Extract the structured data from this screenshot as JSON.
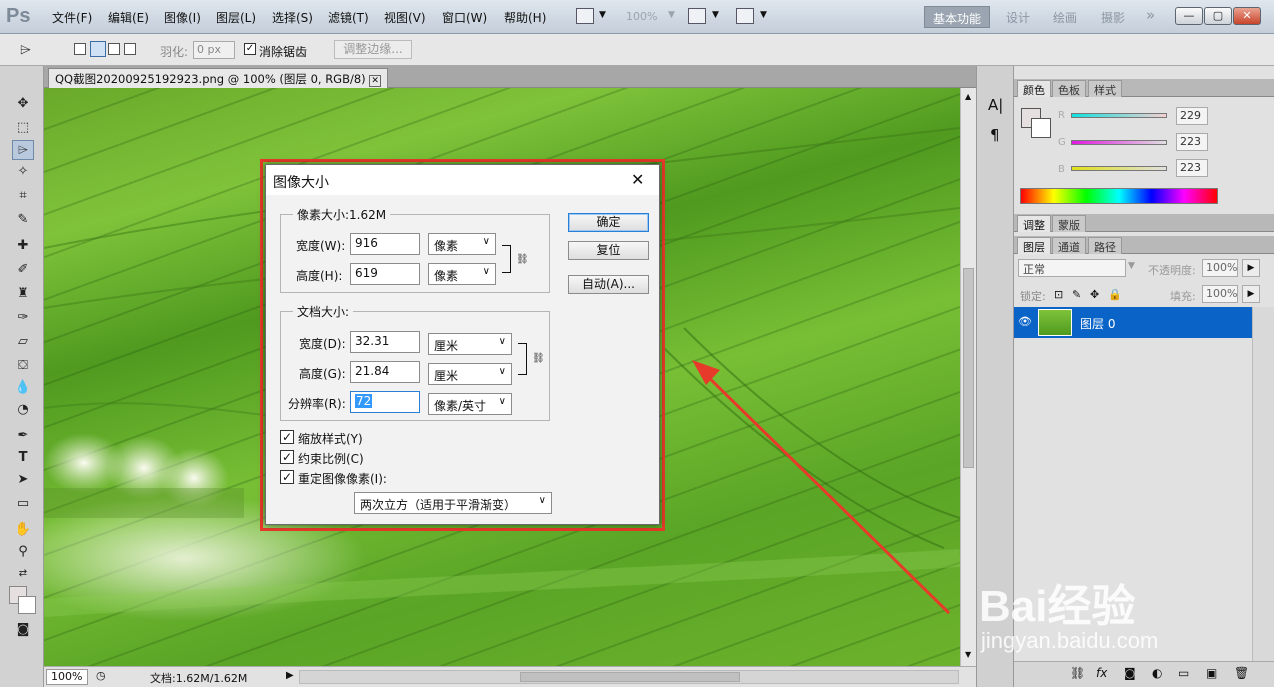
{
  "app": {
    "logo": "Ps"
  },
  "menu": [
    "文件(F)",
    "编辑(E)",
    "图像(I)",
    "图层(L)",
    "选择(S)",
    "滤镜(T)",
    "视图(V)",
    "窗口(W)",
    "帮助(H)"
  ],
  "toolbar": {
    "zoom": "100%"
  },
  "workspaces": [
    "基本功能",
    "设计",
    "绘画",
    "摄影"
  ],
  "workspace_more": "»",
  "window_buttons": [
    "—",
    "▢",
    "✕"
  ],
  "options": {
    "feather_label": "羽化:",
    "feather_value": "0 px",
    "antialias_label": "消除锯齿",
    "refine_edge": "调整边缘..."
  },
  "document": {
    "tab_title": "QQ截图20200925192923.png @ 100% (图层 0, RGB/8)",
    "zoom": "100%",
    "doc_info": "文档:1.62M/1.62M"
  },
  "panels": {
    "color_tabs": [
      "颜色",
      "色板",
      "样式"
    ],
    "r": "229",
    "g": "223",
    "b": "223",
    "r_label": "R",
    "g_label": "G",
    "b_label": "B",
    "adjust_tabs": [
      "调整",
      "蒙版"
    ],
    "layer_tabs": [
      "图层",
      "通道",
      "路径"
    ],
    "blend_mode": "正常",
    "opacity_label": "不透明度:",
    "opacity": "100%",
    "lock_label": "锁定:",
    "fill_label": "填充:",
    "fill": "100%",
    "layer_name": "图层 0"
  },
  "dialog": {
    "title": "图像大小",
    "close": "✕",
    "pixel_group": "像素大小:1.62M",
    "width_label": "宽度(W):",
    "width_value": "916",
    "width_unit": "像素",
    "height_label": "高度(H):",
    "height_value": "619",
    "height_unit": "像素",
    "doc_group": "文档大小:",
    "dwidth_label": "宽度(D):",
    "dwidth_value": "32.31",
    "dwidth_unit": "厘米",
    "dheight_label": "高度(G):",
    "dheight_value": "21.84",
    "dheight_unit": "厘米",
    "res_label": "分辨率(R):",
    "res_value": "72",
    "res_unit": "像素/英寸",
    "ok": "确定",
    "reset": "复位",
    "auto": "自动(A)...",
    "scale_styles": "缩放样式(Y)",
    "constrain": "约束比例(C)",
    "resample": "重定图像像素(I):",
    "resample_method": "两次立方（适用于平滑渐变）"
  },
  "watermark": {
    "brand": "Bai经验",
    "url": "jingyan.baidu.com"
  },
  "colors": {
    "highlight": "#e83a2a",
    "selection": "#0a64c8"
  }
}
